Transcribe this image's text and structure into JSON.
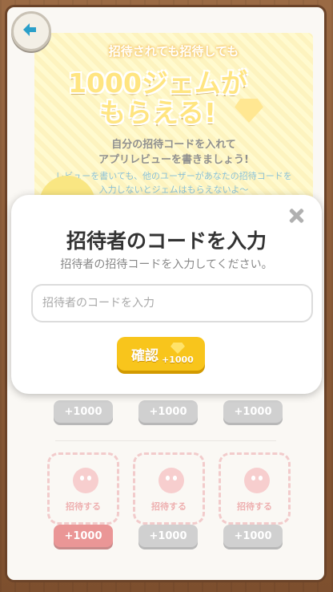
{
  "background": {
    "banner": {
      "top_text": "招待されても招待しても",
      "headline": "1000ジェムが\nもらえる!",
      "instruction": "自分の招待コードを入れて\nアプリレビューを書きましょう!",
      "note": "レビューを書いても、他のユーザーがあなたの招待コードを\n入力しないとジェムはもらえないよ〜"
    },
    "reward_labels": [
      "+1000",
      "+1000",
      "+1000"
    ],
    "slots": [
      "招待する",
      "招待する",
      "招待する"
    ],
    "slot_rewards": [
      "+1000",
      "+1000",
      "+1000"
    ]
  },
  "modal": {
    "title": "招待者のコードを入力",
    "subtitle": "招待者の招待コードを入力してください。",
    "input_placeholder": "招待者のコードを入力",
    "input_value": "",
    "confirm_label": "確認",
    "confirm_bonus": "+1000"
  },
  "colors": {
    "accent_yellow": "#f8c51c",
    "reward_red": "#d94040",
    "back_arrow": "#2a9fc9"
  }
}
